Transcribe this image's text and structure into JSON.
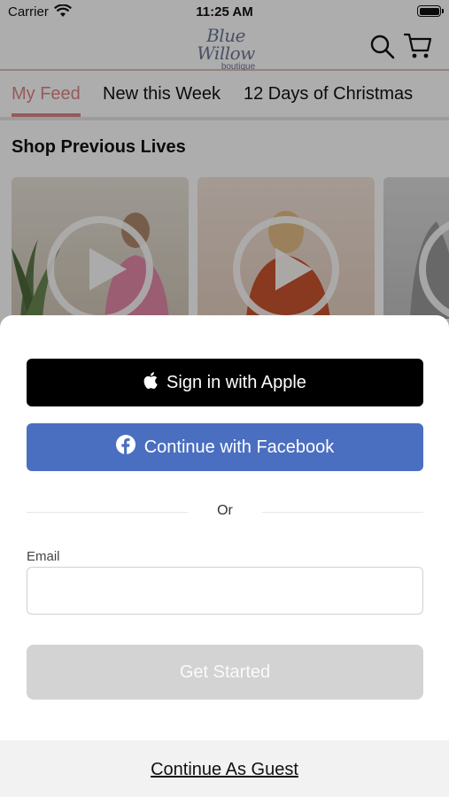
{
  "status_bar": {
    "carrier": "Carrier",
    "time": "11:25 AM",
    "wifi_icon": "wifi-icon",
    "battery_icon": "battery-icon"
  },
  "header": {
    "logo_main": "Blue Willow",
    "logo_sub": "boutique",
    "search_icon": "search-icon",
    "cart_icon": "cart-icon"
  },
  "tabs": [
    {
      "label": "My Feed",
      "active": true
    },
    {
      "label": "New this Week",
      "active": false
    },
    {
      "label": "12 Days of Christmas",
      "active": false
    }
  ],
  "section": {
    "title": "Shop Previous Lives"
  },
  "videos": [
    {
      "thumb_color": "#d6cdbf",
      "play_icon": "play-icon"
    },
    {
      "thumb_color": "#e9d3c4",
      "play_icon": "play-icon"
    },
    {
      "thumb_color": "#c9c9c9",
      "play_icon": "play-icon"
    }
  ],
  "login_sheet": {
    "apple_button": "Sign in with Apple",
    "facebook_button": "Continue with Facebook",
    "or_text": "Or",
    "email_label": "Email",
    "email_value": "",
    "email_placeholder": "",
    "get_started_button": "Get Started",
    "guest_link": "Continue As Guest"
  },
  "colors": {
    "accent": "#e08585",
    "facebook": "#4a6fc0",
    "apple": "#000000",
    "disabled_button": "#d3d3d3",
    "logo": "#6c7895"
  }
}
